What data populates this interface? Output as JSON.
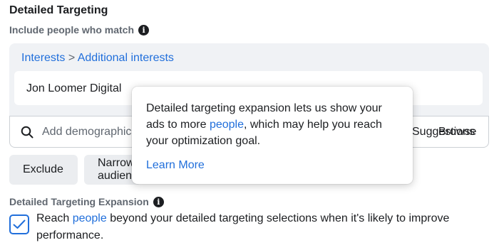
{
  "section": {
    "title": "Detailed Targeting",
    "include_label": "Include people who match",
    "info_icon": "info-icon"
  },
  "breadcrumb": {
    "part1": "Interests",
    "separator": ">",
    "part2": "Additional interests"
  },
  "selected_item": "Jon Loomer Digital",
  "search": {
    "placeholder": "Add demographics, interests or behaviors",
    "suggestions_label": "Suggestions",
    "browse_label": "Browse",
    "icon": "search-icon"
  },
  "buttons": {
    "exclude": "Exclude",
    "narrow": "Narrow audience"
  },
  "expansion": {
    "title": "Detailed Targeting Expansion",
    "checked": true,
    "text_before": "Reach ",
    "text_link": "people",
    "text_after": " beyond your detailed targeting selections when it's likely to improve performance."
  },
  "tooltip": {
    "text_before": "Detailed targeting expansion lets us show your ads to more ",
    "text_link": "people",
    "text_after": ", which may help you reach your optimization goal.",
    "learn_more": "Learn More"
  },
  "colors": {
    "link": "#216fdb",
    "panel_bg": "#f0f2f5",
    "button_bg": "#ebedf0"
  }
}
